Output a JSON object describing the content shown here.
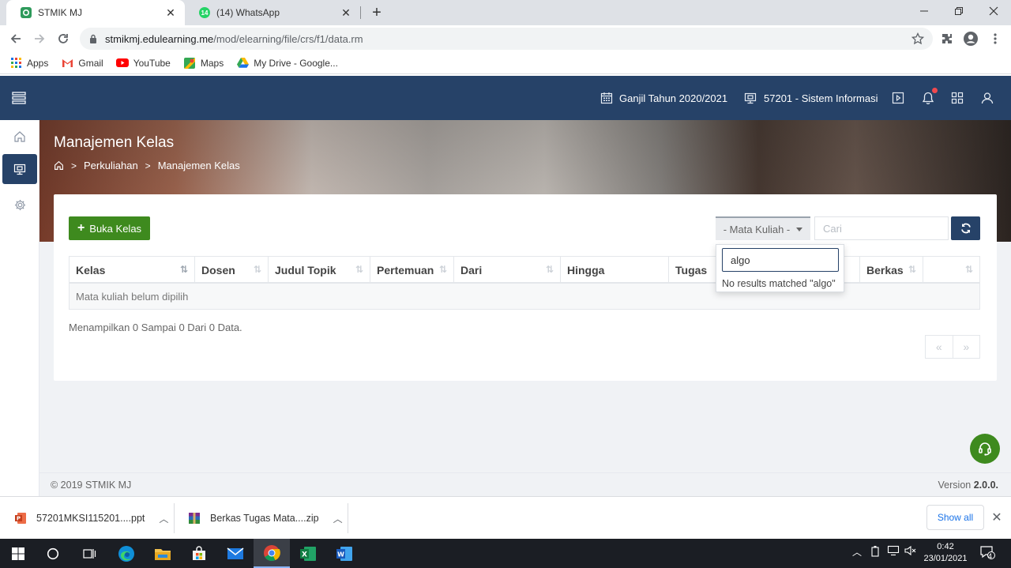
{
  "browser": {
    "tabs": [
      {
        "title": "STMIK MJ",
        "active": true
      },
      {
        "title": "(14) WhatsApp",
        "badge": "14",
        "active": false
      }
    ],
    "new_tab": "+",
    "address": {
      "host": "stmikmj.edulearning.me",
      "path": "/mod/elearning/file/crs/f1/data.rm"
    },
    "bookmarks": [
      "Apps",
      "Gmail",
      "YouTube",
      "Maps",
      "My Drive - Google..."
    ]
  },
  "header": {
    "semester": "Ganjil Tahun 2020/2021",
    "program": "57201 - Sistem Informasi"
  },
  "page": {
    "title": "Manajemen Kelas",
    "breadcrumb": [
      "Perkuliahan",
      "Manajemen Kelas"
    ]
  },
  "toolbar": {
    "add_label": "Buka Kelas",
    "course_select": "- Mata Kuliah -",
    "search_placeholder": "Cari"
  },
  "dropdown": {
    "query": "algo",
    "message": "No results matched \"algo\""
  },
  "table": {
    "columns": [
      "Kelas",
      "Dosen",
      "Judul Topik",
      "Pertemuan",
      "Dari",
      "Hingga",
      "Tugas",
      "",
      "Berkas",
      ""
    ],
    "empty_message": "Mata kuliah belum dipilih",
    "info": "Menampilkan 0 Sampai 0 Dari 0 Data.",
    "pager": {
      "prev": "«",
      "next": "»"
    }
  },
  "footer": {
    "copyright": "© 2019 STMIK MJ",
    "version_label": "Version",
    "version": "2.0.0."
  },
  "downloads": {
    "items": [
      "57201MKSI115201....ppt",
      "Berkas Tugas Mata....zip"
    ],
    "show_all": "Show all"
  },
  "taskbar": {
    "time": "0:42",
    "date": "23/01/2021",
    "notifications": "4"
  },
  "colors": {
    "header": "#264268",
    "primary_green": "#3e8a1e"
  }
}
